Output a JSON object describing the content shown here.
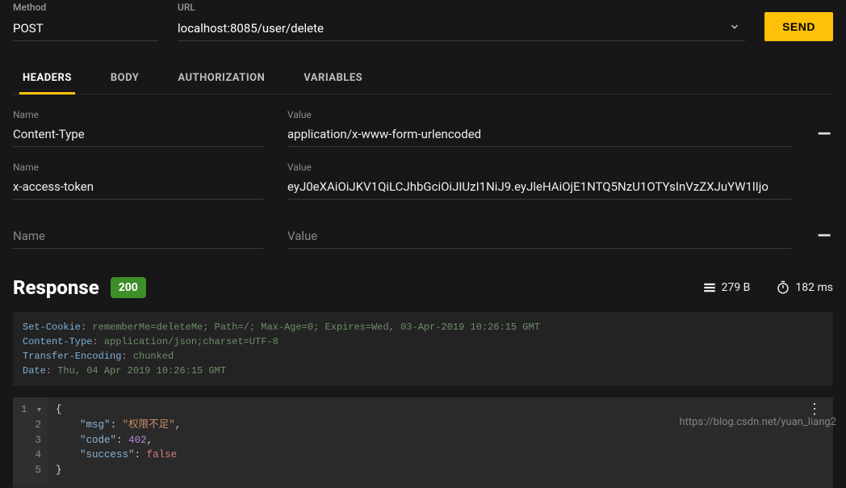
{
  "request": {
    "method_label": "Method",
    "method_value": "POST",
    "url_label": "URL",
    "url_value": "localhost:8085/user/delete",
    "send_label": "SEND"
  },
  "tabs": {
    "headers": "HEADERS",
    "body": "BODY",
    "authorization": "AUTHORIZATION",
    "variables": "VARIABLES"
  },
  "header_labels": {
    "name": "Name",
    "value": "Value"
  },
  "headers": [
    {
      "name": "Content-Type",
      "value": "application/x-www-form-urlencoded"
    },
    {
      "name": "x-access-token",
      "value": "eyJ0eXAiOiJKV1QiLCJhbGciOiJIUzI1NiJ9.eyJleHAiOjE1NTQ5NzU1OTYsInVzZXJuYW1lIjo"
    }
  ],
  "header_placeholder": {
    "name": "Name",
    "value": "Value"
  },
  "response": {
    "title": "Response",
    "status": "200",
    "size": "279 B",
    "time": "182 ms"
  },
  "resp_headers": [
    {
      "key": "Set-Cookie",
      "value": "rememberMe=deleteMe; Path=/; Max-Age=0; Expires=Wed, 03-Apr-2019 10:26:15 GMT"
    },
    {
      "key": "Content-Type",
      "value": "application/json;charset=UTF-8"
    },
    {
      "key": "Transfer-Encoding",
      "value": "chunked"
    },
    {
      "key": "Date",
      "value": "Thu, 04 Apr 2019 10:26:15 GMT"
    }
  ],
  "json_body": {
    "msg_key": "\"msg\"",
    "msg_val": "\"权限不足\"",
    "code_key": "\"code\"",
    "code_val": "402",
    "success_key": "\"success\"",
    "success_val": "false"
  },
  "gutter": [
    "1",
    "2",
    "3",
    "4",
    "5"
  ],
  "watermark": "https://blog.csdn.net/yuan_liang2"
}
